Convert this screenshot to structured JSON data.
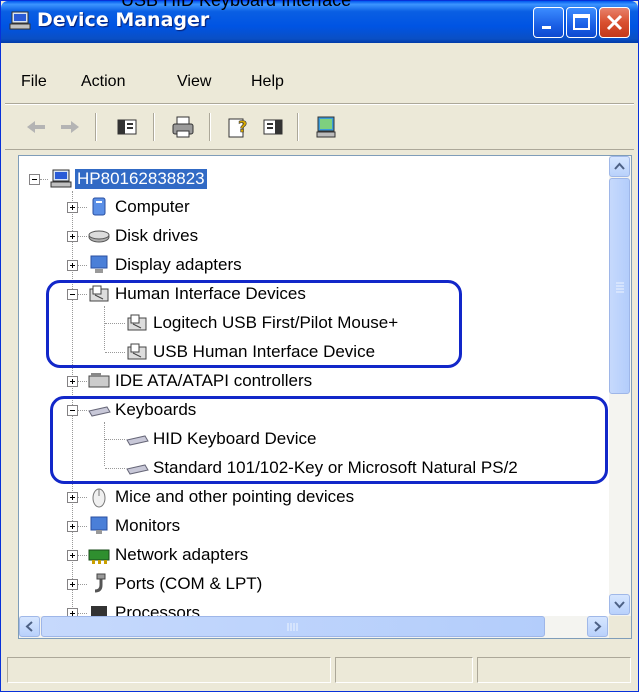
{
  "caption": "USB HID Keyboard Interface",
  "window": {
    "title": "Device Manager",
    "app_icon": "computer-icon",
    "controls": [
      "minimize-icon",
      "maximize-icon",
      "close-icon"
    ]
  },
  "menu": {
    "items": [
      {
        "label": "File"
      },
      {
        "label": "Action"
      },
      {
        "label": "View"
      },
      {
        "label": "Help"
      }
    ]
  },
  "toolbar": {
    "buttons": [
      "back-icon",
      "forward-icon",
      "show-hide-console-tree-icon",
      "print-icon",
      "help-icon",
      "properties-icon",
      "scan-hardware-icon"
    ]
  },
  "tree": {
    "root": "HP80162838823",
    "items": [
      {
        "label": "Computer",
        "expanded": false
      },
      {
        "label": "Disk drives",
        "expanded": false
      },
      {
        "label": "Display adapters",
        "expanded": false
      },
      {
        "label": "Human Interface Devices",
        "expanded": true
      },
      {
        "label": "Logitech USB First/Pilot Mouse+"
      },
      {
        "label": "USB Human Interface Device"
      },
      {
        "label": "IDE ATA/ATAPI controllers",
        "expanded": false
      },
      {
        "label": "Keyboards",
        "expanded": true
      },
      {
        "label": "HID Keyboard Device"
      },
      {
        "label": "Standard 101/102-Key or Microsoft Natural PS/2"
      },
      {
        "label": "Mice and other pointing devices",
        "expanded": false
      },
      {
        "label": "Monitors",
        "expanded": false
      },
      {
        "label": "Network adapters",
        "expanded": false
      },
      {
        "label": "Ports (COM & LPT)",
        "expanded": false
      },
      {
        "label": "Processors",
        "expanded": false
      }
    ]
  },
  "colors": {
    "titlebar": "#0054e3",
    "selection": "#316ac5",
    "highlight_box": "#1227c9",
    "chrome": "#ece9d8"
  }
}
